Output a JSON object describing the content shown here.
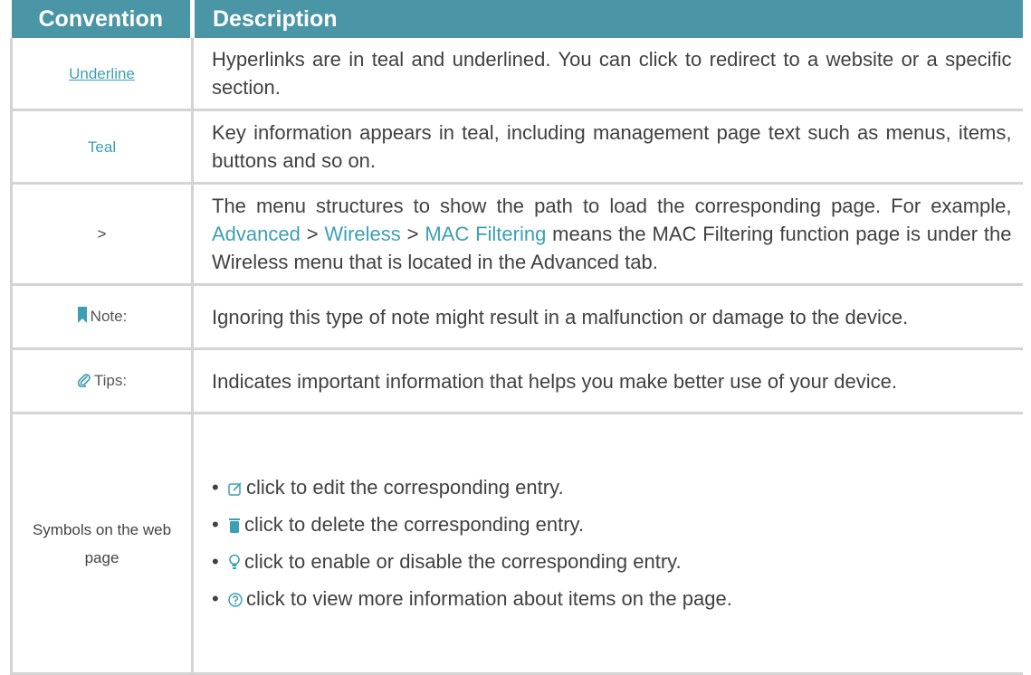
{
  "header": {
    "convention": "Convention",
    "description": "Description"
  },
  "rows": [
    {
      "convention": "Underline",
      "description": "Hyperlinks are in teal and underlined. You can click to redirect to a website or a specific section."
    },
    {
      "convention": "Teal",
      "description": "Key information appears in teal, including management page text such as menus, items, buttons and so on."
    },
    {
      "convention": ">",
      "desc_parts": [
        "The menu structures to show the path to load the corresponding page. For example, ",
        "Advanced",
        " > ",
        "Wireless",
        " > ",
        "MAC Filtering",
        " means the MAC Filtering function page is under the Wireless menu that is located in the Advanced tab."
      ]
    },
    {
      "convention": "Note:",
      "icon": "bookmark-icon",
      "description": "Ignoring this type of note might result in a malfunction or damage to the device."
    },
    {
      "convention": "Tips:",
      "icon": "paperclip-icon",
      "description": "Indicates important information that helps you make better use of your device."
    },
    {
      "convention": "Symbols on the web page",
      "items": [
        {
          "icon": "edit-icon",
          "text": "click to edit the corresponding entry."
        },
        {
          "icon": "trash-icon",
          "text": "click to delete the corresponding entry."
        },
        {
          "icon": "bulb-icon",
          "text": "click to enable or disable the corresponding entry."
        },
        {
          "icon": "help-icon",
          "text": "click to view more information about items on the page."
        }
      ]
    }
  ],
  "colors": {
    "header_bg": "#4a95a6",
    "teal": "#3d9fb3",
    "border": "#d4d4d4"
  }
}
